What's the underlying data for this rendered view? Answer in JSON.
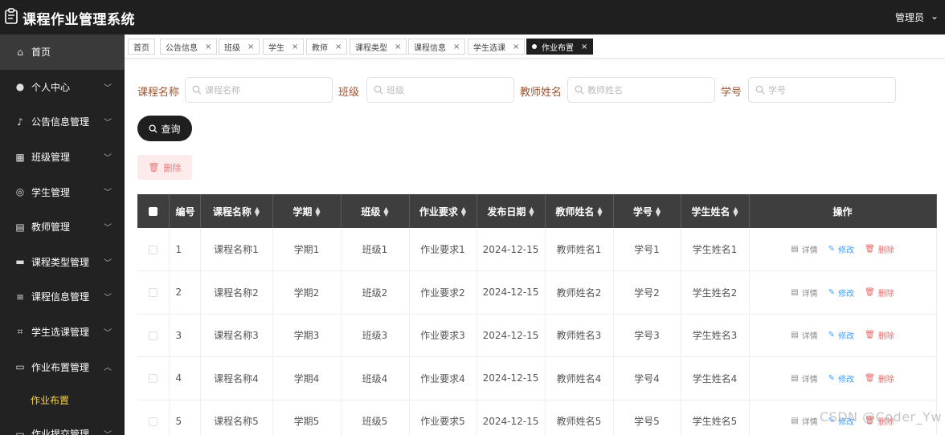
{
  "app": {
    "title": "课程作业管理系统",
    "user": "管理员",
    "user_caret": "⌄"
  },
  "sidebar": {
    "items": [
      {
        "label": "首页",
        "icon": "home-icon",
        "glyph": "⌂",
        "active": true,
        "expanded": null
      },
      {
        "label": "个人中心",
        "icon": "user-icon",
        "glyph": "●",
        "active": false,
        "expanded": false
      },
      {
        "label": "公告信息管理",
        "icon": "microphone-icon",
        "glyph": "♪",
        "active": false,
        "expanded": false
      },
      {
        "label": "班级管理",
        "icon": "grid-icon",
        "glyph": "▦",
        "active": false,
        "expanded": false
      },
      {
        "label": "学生管理",
        "icon": "circle-icon",
        "glyph": "◎",
        "active": false,
        "expanded": false
      },
      {
        "label": "教师管理",
        "icon": "clipboard-icon",
        "glyph": "▤",
        "active": false,
        "expanded": false
      },
      {
        "label": "课程类型管理",
        "icon": "briefcase-icon",
        "glyph": "▬",
        "active": false,
        "expanded": false
      },
      {
        "label": "课程信息管理",
        "icon": "list-icon",
        "glyph": "≡",
        "active": false,
        "expanded": false
      },
      {
        "label": "学生选课管理",
        "icon": "crop-icon",
        "glyph": "⌗",
        "active": false,
        "expanded": false
      },
      {
        "label": "作业布置管理",
        "icon": "message-icon",
        "glyph": "▭",
        "active": false,
        "expanded": true
      }
    ],
    "submenu_label": "作业布置",
    "last_item_label": "作业提交管理"
  },
  "tabs": [
    {
      "label": "首页",
      "closable": false
    },
    {
      "label": "公告信息",
      "closable": true
    },
    {
      "label": "班级",
      "closable": true
    },
    {
      "label": "学生",
      "closable": true
    },
    {
      "label": "教师",
      "closable": true
    },
    {
      "label": "课程类型",
      "closable": true
    },
    {
      "label": "课程信息",
      "closable": true
    },
    {
      "label": "学生选课",
      "closable": true
    },
    {
      "label": "作业布置",
      "closable": true,
      "active": true
    }
  ],
  "tab_close": "×",
  "filters": [
    {
      "label": "课程名称",
      "placeholder": "课程名称"
    },
    {
      "label": "班级",
      "placeholder": "班级"
    },
    {
      "label": "教师姓名",
      "placeholder": "教师姓名"
    },
    {
      "label": "学号",
      "placeholder": "学号"
    }
  ],
  "buttons": {
    "query": "查询",
    "delete": "删除"
  },
  "table": {
    "columns": [
      "编号",
      "课程名称",
      "学期",
      "班级",
      "作业要求",
      "发布日期",
      "教师姓名",
      "学号",
      "学生姓名",
      "操作"
    ],
    "rows": [
      [
        "1",
        "课程名称1",
        "学期1",
        "班级1",
        "作业要求1",
        "2024-12-15",
        "教师姓名1",
        "学号1",
        "学生姓名1"
      ],
      [
        "2",
        "课程名称2",
        "学期2",
        "班级2",
        "作业要求2",
        "2024-12-15",
        "教师姓名2",
        "学号2",
        "学生姓名2"
      ],
      [
        "3",
        "课程名称3",
        "学期3",
        "班级3",
        "作业要求3",
        "2024-12-15",
        "教师姓名3",
        "学号3",
        "学生姓名3"
      ],
      [
        "4",
        "课程名称4",
        "学期4",
        "班级4",
        "作业要求4",
        "2024-12-15",
        "教师姓名4",
        "学号4",
        "学生姓名4"
      ],
      [
        "5",
        "课程名称5",
        "学期5",
        "班级5",
        "作业要求5",
        "2024-12-15",
        "教师姓名5",
        "学号5",
        "学生姓名5"
      ]
    ],
    "actions": {
      "detail": "详情",
      "edit": "修改",
      "delete": "删除"
    }
  },
  "watermark": "CSDN @Coder_Yw",
  "colors": {
    "dark": "#1f1f1f",
    "sidebar": "#222222",
    "accent_yellow": "#f5d142",
    "link_blue": "#409eff",
    "danger_red": "#ee6666",
    "label_brown": "#a0522d"
  }
}
